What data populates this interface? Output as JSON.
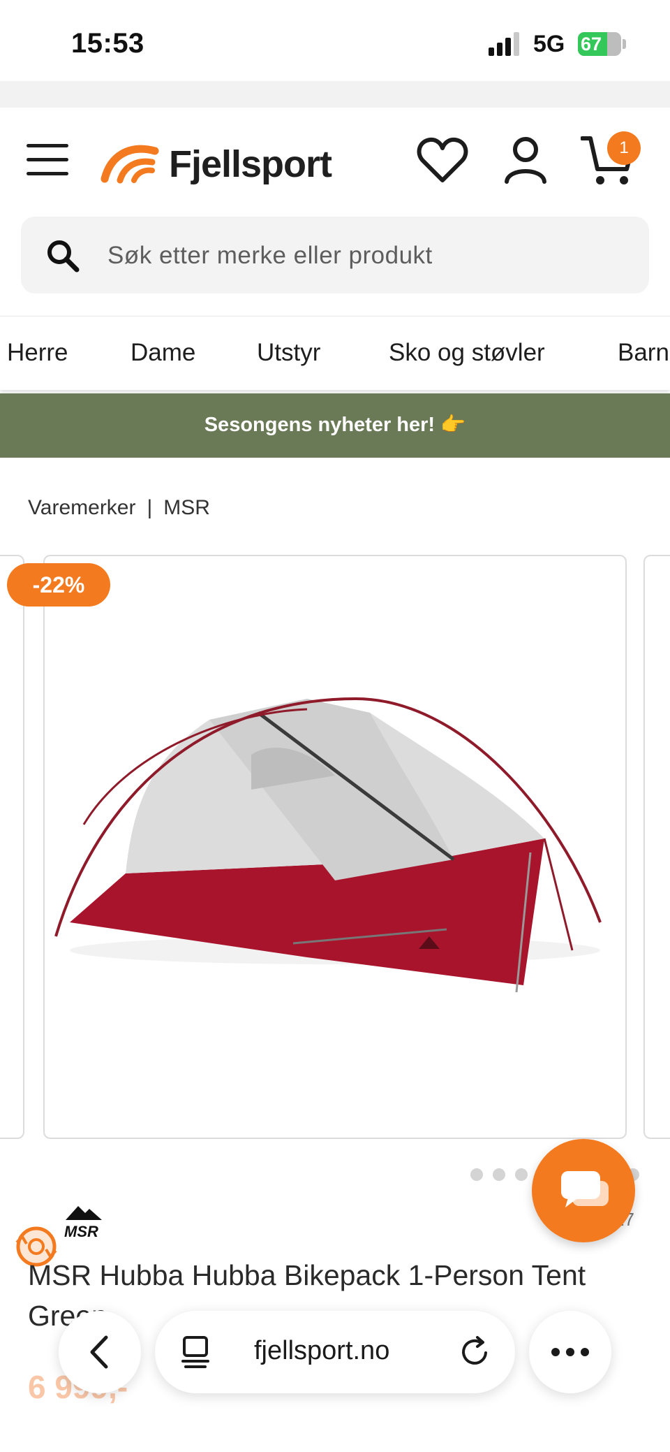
{
  "status_bar": {
    "time": "15:53",
    "network": "5G",
    "battery": "67"
  },
  "header": {
    "logo_text": "Fjellsport",
    "cart_count": "1"
  },
  "search": {
    "placeholder": "Søk etter merke eller produkt"
  },
  "nav": {
    "items": [
      "Herre",
      "Dame",
      "Utstyr",
      "Sko og støvler",
      "Barn"
    ]
  },
  "promo": {
    "text": "Sesongens nyheter her! 👉"
  },
  "breadcrumb": {
    "root": "Varemerker",
    "separator": "|",
    "current": "MSR"
  },
  "product": {
    "discount": "-22%",
    "brand": "MSR",
    "title": "MSR Hubba Hubba Bikepack 1-Person Tent Green",
    "price": "6 999,-",
    "reviews_count": "27",
    "gallery_total": 8,
    "gallery_current": 0
  },
  "browser": {
    "url": "fjellsport.no"
  },
  "colors": {
    "accent": "#f47a20",
    "promo_bg": "#6a7a56",
    "tent_red": "#a8142c"
  }
}
